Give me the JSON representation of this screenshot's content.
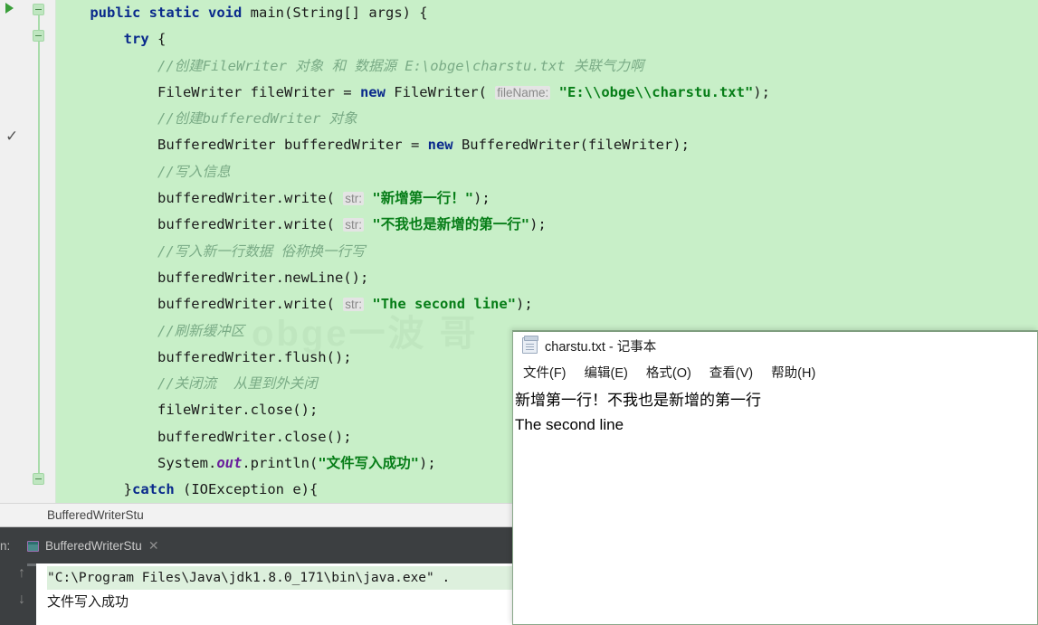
{
  "editor": {
    "gutter": {
      "run_icon": "run-arrow-icon",
      "check_icon": "checkmark-icon"
    },
    "watermark": "obge一波 哥",
    "lines": [
      {
        "indent": 1,
        "tokens": [
          {
            "t": "kw",
            "v": "public"
          },
          {
            "t": "p",
            "v": " "
          },
          {
            "t": "kw",
            "v": "static"
          },
          {
            "t": "p",
            "v": " "
          },
          {
            "t": "kw",
            "v": "void"
          },
          {
            "t": "p",
            "v": " main(String[] args) {"
          }
        ]
      },
      {
        "indent": 2,
        "tokens": [
          {
            "t": "kw",
            "v": "try"
          },
          {
            "t": "p",
            "v": " {"
          }
        ]
      },
      {
        "indent": 3,
        "tokens": [
          {
            "t": "cmt",
            "v": "//创建FileWriter 对象 和 数据源 E:\\obge\\charstu.txt 关联气力啊"
          }
        ]
      },
      {
        "indent": 3,
        "tokens": [
          {
            "t": "p",
            "v": "FileWriter fileWriter = "
          },
          {
            "t": "kw",
            "v": "new"
          },
          {
            "t": "p",
            "v": " FileWriter( "
          },
          {
            "t": "hint",
            "v": "fileName:"
          },
          {
            "t": "p",
            "v": " "
          },
          {
            "t": "str",
            "v": "\"E:\\\\obge\\\\charstu.txt\""
          },
          {
            "t": "p",
            "v": ");"
          }
        ]
      },
      {
        "indent": 3,
        "tokens": [
          {
            "t": "cmt",
            "v": "//创建bufferedWriter 对象"
          }
        ]
      },
      {
        "indent": 3,
        "tokens": [
          {
            "t": "p",
            "v": "BufferedWriter bufferedWriter = "
          },
          {
            "t": "kw",
            "v": "new"
          },
          {
            "t": "p",
            "v": " BufferedWriter(fileWriter);"
          }
        ]
      },
      {
        "indent": 3,
        "tokens": [
          {
            "t": "cmt",
            "v": "//写入信息"
          }
        ]
      },
      {
        "indent": 3,
        "tokens": [
          {
            "t": "p",
            "v": "bufferedWriter.write( "
          },
          {
            "t": "hint",
            "v": "str:"
          },
          {
            "t": "p",
            "v": " "
          },
          {
            "t": "str",
            "v": "\"新增第一行！\""
          },
          {
            "t": "p",
            "v": ");"
          }
        ]
      },
      {
        "indent": 3,
        "tokens": [
          {
            "t": "p",
            "v": "bufferedWriter.write( "
          },
          {
            "t": "hint",
            "v": "str:"
          },
          {
            "t": "p",
            "v": " "
          },
          {
            "t": "str",
            "v": "\"不我也是新增的第一行\""
          },
          {
            "t": "p",
            "v": ");"
          }
        ]
      },
      {
        "indent": 3,
        "tokens": [
          {
            "t": "cmt",
            "v": "//写入新一行数据 俗称换一行写"
          }
        ]
      },
      {
        "indent": 3,
        "tokens": [
          {
            "t": "p",
            "v": "bufferedWriter.newLine();"
          }
        ]
      },
      {
        "indent": 3,
        "tokens": [
          {
            "t": "p",
            "v": "bufferedWriter.write( "
          },
          {
            "t": "hint",
            "v": "str:"
          },
          {
            "t": "p",
            "v": " "
          },
          {
            "t": "str",
            "v": "\"The second line\""
          },
          {
            "t": "p",
            "v": ");"
          }
        ]
      },
      {
        "indent": 3,
        "tokens": [
          {
            "t": "cmt",
            "v": "//刷新缓冲区"
          }
        ]
      },
      {
        "indent": 3,
        "tokens": [
          {
            "t": "p",
            "v": "bufferedWriter.flush();"
          }
        ]
      },
      {
        "indent": 3,
        "tokens": [
          {
            "t": "cmt",
            "v": "//关闭流  从里到外关闭"
          }
        ]
      },
      {
        "indent": 3,
        "tokens": [
          {
            "t": "p",
            "v": "fileWriter.close();"
          }
        ]
      },
      {
        "indent": 3,
        "tokens": [
          {
            "t": "p",
            "v": "bufferedWriter.close();"
          }
        ]
      },
      {
        "indent": 3,
        "tokens": [
          {
            "t": "p",
            "v": "System."
          },
          {
            "t": "it",
            "v": "out"
          },
          {
            "t": "p",
            "v": ".println("
          },
          {
            "t": "str",
            "v": "\"文件写入成功\""
          },
          {
            "t": "p",
            "v": ");"
          }
        ]
      },
      {
        "indent": 2,
        "tokens": [
          {
            "t": "p",
            "v": "}"
          },
          {
            "t": "kw",
            "v": "catch"
          },
          {
            "t": "p",
            "v": " (IOException e){"
          }
        ]
      }
    ]
  },
  "breadcrumb": {
    "text": "BufferedWriterStu"
  },
  "console": {
    "label": "n:",
    "tab_title": "BufferedWriterStu",
    "tab_close": "✕",
    "scroll_up_icon": "arrow-up-icon",
    "scroll_down_icon": "arrow-down-icon",
    "output_line_1": "\"C:\\Program Files\\Java\\jdk1.8.0_171\\bin\\java.exe\" .",
    "output_line_2": "文件写入成功"
  },
  "notepad": {
    "title": "charstu.txt - 记事本",
    "icon": "notepad-document-icon",
    "menu": [
      "文件(F)",
      "编辑(E)",
      "格式(O)",
      "查看(V)",
      "帮助(H)"
    ],
    "content_lines": [
      "新增第一行！不我也是新增的第一行",
      "The second line"
    ]
  },
  "colors": {
    "editor_background": "#c8efc8",
    "keyword": "#0a2a8c",
    "comment": "#7aab86",
    "string": "#067d17",
    "console_background": "#3c3f41",
    "run_arrow": "#3a9e3a"
  }
}
